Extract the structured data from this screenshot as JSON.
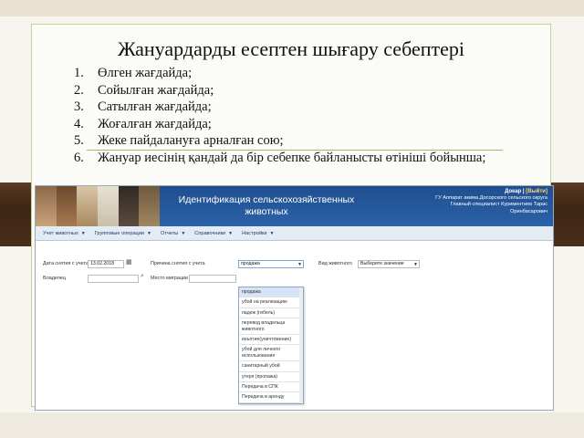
{
  "slide": {
    "title": "Жануардарды есептен шығару себептері",
    "reasons": [
      {
        "num": "1.",
        "text": "Өлген жағдайда;"
      },
      {
        "num": "2.",
        "text": "Сойылған жағдайда;"
      },
      {
        "num": "3.",
        "text": "Сатылған жағдайда;"
      },
      {
        "num": "4.",
        "text": "Жоғалған жағдайда;"
      },
      {
        "num": "5.",
        "text": "Жеке пайдалануға арналған сою;"
      },
      {
        "num": "6.",
        "text": "Жануар иесінің қандай да бір себепке байланысты өтініші бойынша;"
      }
    ]
  },
  "app": {
    "title": "Идентификация сельскохозяйственных животных",
    "user": {
      "login": "Докар",
      "exit": "[Выйти]",
      "org": "ГУ Аппарат акима Досорского сельского округа",
      "role": "Главный специалист Куриментиев Тарас",
      "name": "Оринбасарович"
    },
    "menu": [
      {
        "label": "Учет животных"
      },
      {
        "label": "Групповые операции"
      },
      {
        "label": "Отчеты"
      },
      {
        "label": "Справочники"
      },
      {
        "label": "Настройки"
      }
    ],
    "form": {
      "date_label": "Дата снятия с учета",
      "date_value": "13.02.2018",
      "owner_label": "Владелец",
      "reason_label": "Причина снятия с учета",
      "reason_value": "продажа",
      "place_label": "Место миграции",
      "animal_type_label": "Вид животного",
      "animal_type_value": "Выберите значение"
    },
    "reason_options": [
      "продажа",
      "убой на реализацию",
      "падеж (гибель)",
      "перевод владельца животного",
      "изъятие(уничтожение)",
      "убой для личного использования",
      "санитарный убой",
      "утеря (пропажа)",
      "Передача в СПК",
      "Передача в аренду"
    ],
    "colors": {
      "header": "#2b62a8",
      "menu": "#e3ebf5"
    }
  }
}
